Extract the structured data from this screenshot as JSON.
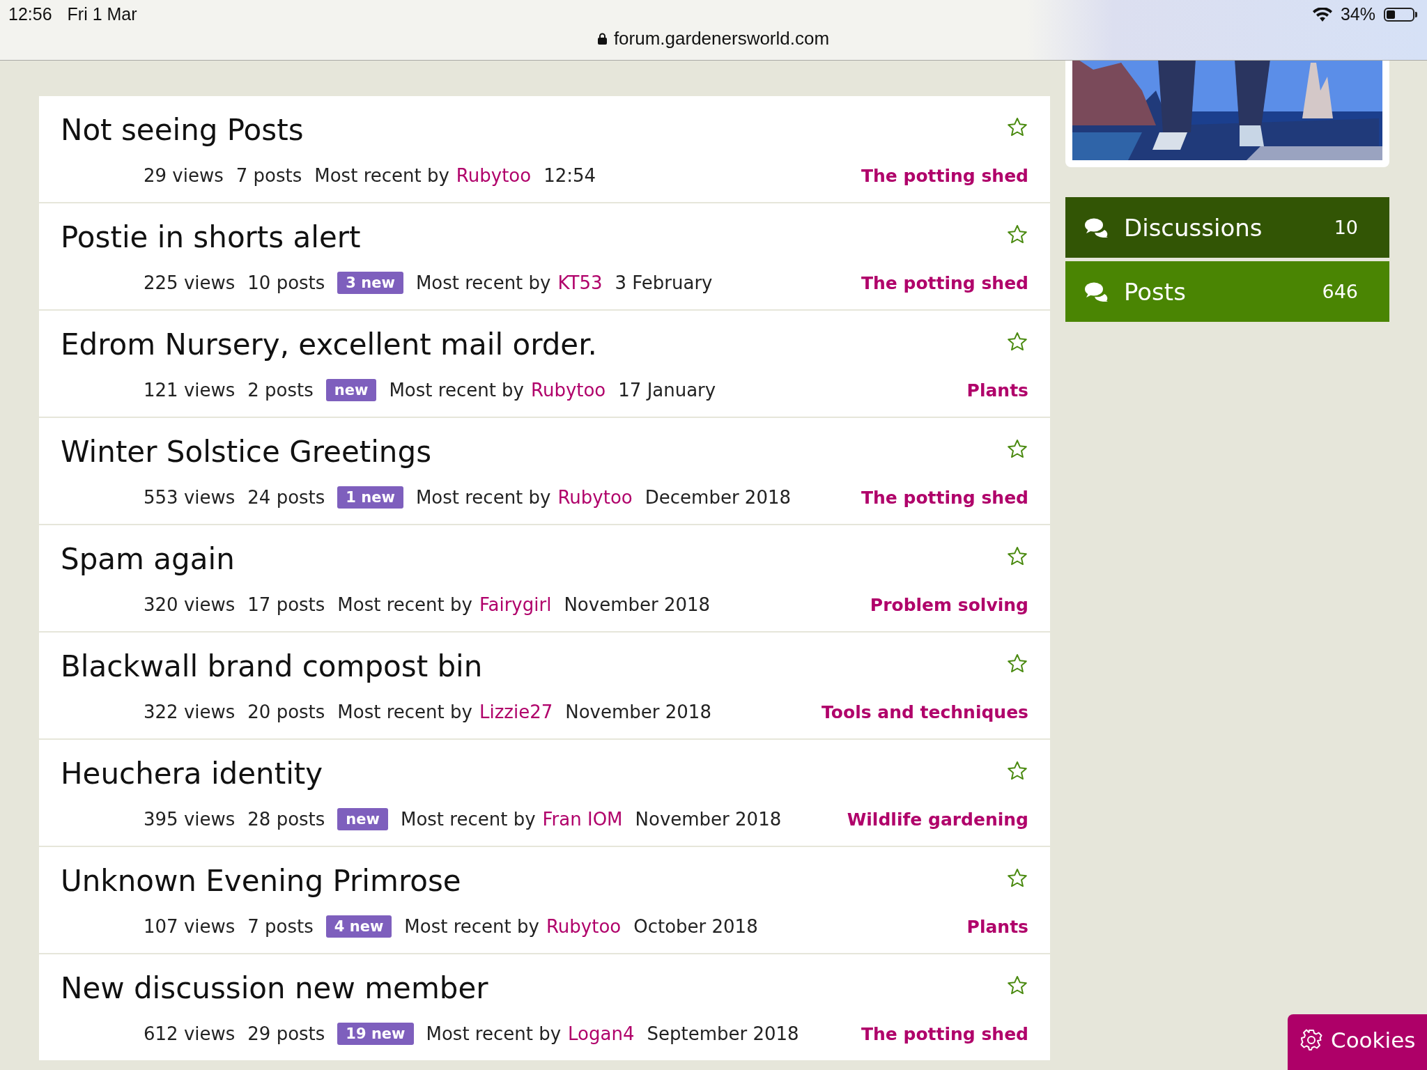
{
  "status_bar": {
    "time": "12:56",
    "date": "Fri 1 Mar",
    "url": "forum.gardenersworld.com",
    "battery": "34%"
  },
  "discussions": [
    {
      "title": "Not seeing Posts",
      "views": "29 views",
      "posts": "7 posts",
      "recent_label": "Most recent by",
      "author": "Rubytoo",
      "when": "12:54",
      "category": "The potting shed",
      "bookmarked": false
    },
    {
      "title": "Postie in shorts alert",
      "views": "225 views",
      "posts": "10 posts",
      "new_badge": "3 new",
      "recent_label": "Most recent by",
      "author": "KT53",
      "when": "3 February",
      "category": "The potting shed",
      "bookmarked": false
    },
    {
      "title": "Edrom Nursery, excellent mail order.",
      "views": "121 views",
      "posts": "2 posts",
      "new_badge": "new",
      "recent_label": "Most recent by",
      "author": "Rubytoo",
      "when": "17 January",
      "category": "Plants",
      "bookmarked": false
    },
    {
      "title": "Winter Solstice Greetings",
      "views": "553 views",
      "posts": "24 posts",
      "new_badge": "1 new",
      "recent_label": "Most recent by",
      "author": "Rubytoo",
      "when": "December 2018",
      "category": "The potting shed",
      "bookmarked": false
    },
    {
      "title": "Spam again",
      "views": "320 views",
      "posts": "17 posts",
      "recent_label": "Most recent by",
      "author": "Fairygirl",
      "when": "November 2018",
      "category": "Problem solving",
      "bookmarked": false
    },
    {
      "title": "Blackwall brand compost bin",
      "views": "322 views",
      "posts": "20 posts",
      "recent_label": "Most recent by",
      "author": "Lizzie27",
      "when": "November 2018",
      "category": "Tools and techniques",
      "bookmarked": false
    },
    {
      "title": "Heuchera identity",
      "views": "395 views",
      "posts": "28 posts",
      "new_badge": "new",
      "recent_label": "Most recent by",
      "author": "Fran IOM",
      "when": "November 2018",
      "category": "Wildlife gardening",
      "bookmarked": false
    },
    {
      "title": "Unknown Evening Primrose",
      "views": "107 views",
      "posts": "7 posts",
      "new_badge": "4 new",
      "recent_label": "Most recent by",
      "author": "Rubytoo",
      "when": "October 2018",
      "category": "Plants",
      "bookmarked": false
    },
    {
      "title": "New discussion new member",
      "views": "612 views",
      "posts": "29 posts",
      "new_badge": "19 new",
      "recent_label": "Most recent by",
      "author": "Logan4",
      "when": "September 2018",
      "category": "The potting shed",
      "bookmarked": false
    }
  ],
  "sidebar": {
    "stats": [
      {
        "label": "Discussions",
        "count": "10",
        "selected": true
      },
      {
        "label": "Posts",
        "count": "646",
        "selected": false
      }
    ]
  },
  "cookies_button": "Cookies"
}
